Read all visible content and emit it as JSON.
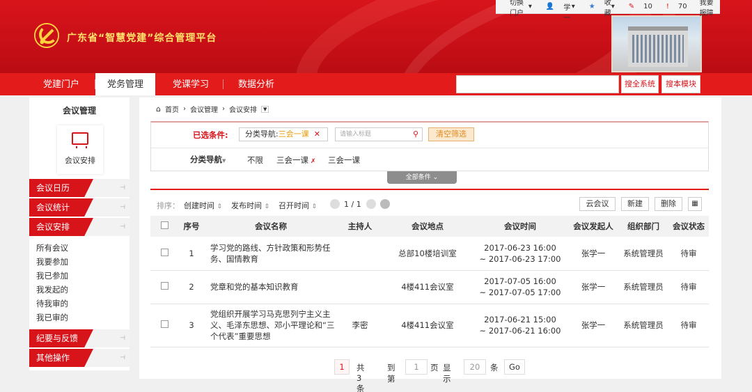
{
  "header": {
    "title": "广东省“智慧党建”综合管理平台",
    "util": {
      "switch_portal": "切换门户",
      "user": "张学一",
      "favorites": "收藏",
      "count_a": "10",
      "count_b": "70",
      "report": "我要报障"
    }
  },
  "nav": {
    "tabs": [
      "党建门户",
      "党务管理",
      "党课学习",
      "数据分析"
    ],
    "active_index": 1,
    "search_all": "搜全系统",
    "search_module": "搜本模块"
  },
  "sidebar": {
    "title": "会议管理",
    "card_label": "会议安排",
    "groups": [
      "会议日历",
      "会议统计",
      "会议安排",
      "纪要与反馈",
      "其他操作"
    ],
    "sub_items": [
      "所有会议",
      "我要参加",
      "我已参加",
      "我发起的",
      "待我审的",
      "我已审的"
    ]
  },
  "breadcrumb": [
    "首页",
    "会议管理",
    "会议安排"
  ],
  "filter": {
    "selected_label": "已选条件:",
    "chip_prefix": "分类导航:",
    "chip_value": "三会一课",
    "search_placeholder": "请输入标题",
    "clear_label": "清空筛选",
    "nav_label": "分类导航",
    "options": [
      "不限",
      "三会一课",
      "三会一课"
    ],
    "all_conditions": "全部条件"
  },
  "toolbar": {
    "sort_label": "排序：",
    "sort_created": "创建时间",
    "sort_published": "发布时间",
    "sort_held": "召开时间",
    "page_indicator": "1 / 1",
    "btn_cloud": "云会议",
    "btn_new": "新建",
    "btn_delete": "删除"
  },
  "table": {
    "headers": [
      "序号",
      "会议名称",
      "主持人",
      "会议地点",
      "会议时间",
      "会议发起人",
      "组织部门",
      "会议状态"
    ],
    "rows": [
      {
        "no": "1",
        "name": "学习党的路线、方针政策和形势任务、国情教育",
        "host": "",
        "place": "总部10楼培训室",
        "time_start": "2017-06-23 16:00",
        "time_end": "~ 2017-06-23 17:00",
        "initiator": "张学一",
        "dept": "系统管理员",
        "status": "待审"
      },
      {
        "no": "2",
        "name": "党章和党的基本知识教育",
        "host": "",
        "place": "4楼411会议室",
        "time_start": "2017-07-05 16:00",
        "time_end": "~ 2017-07-05 17:00",
        "initiator": "张学一",
        "dept": "系统管理员",
        "status": "待审"
      },
      {
        "no": "3",
        "name": "党组织开展学习马克思列宁主义主义、毛泽东思想、邓小平理论和“三个代表”重要思想",
        "host": "李密",
        "place": "4楼411会议室",
        "time_start": "2017-06-21 15:00",
        "time_end": "~ 2017-06-21 16:00",
        "initiator": "张学一",
        "dept": "系统管理员",
        "status": "待审"
      }
    ]
  },
  "pager": {
    "current": "1",
    "total_text": "共 3 条",
    "goto_label": "到第",
    "goto_value": "1",
    "page_unit": "页",
    "show_label": "显示",
    "page_size": "20",
    "size_unit": "条",
    "go": "Go"
  },
  "colors": {
    "brand": "#d8141b",
    "nav": "#e31b1b",
    "accent": "#e79a00"
  }
}
